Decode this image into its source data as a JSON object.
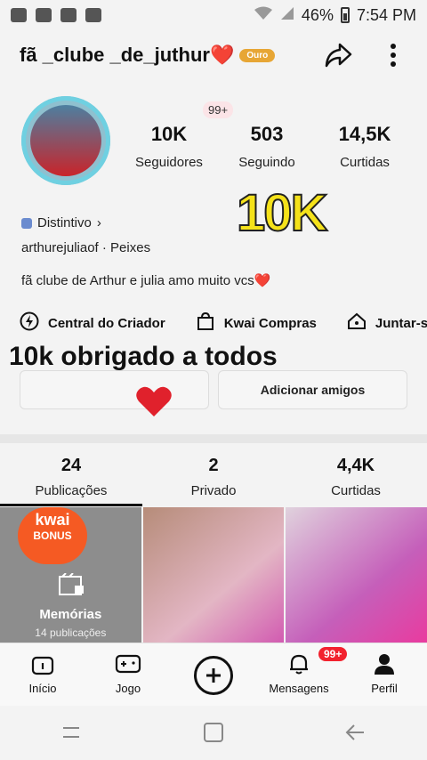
{
  "status": {
    "battery": "46%",
    "time": "7:54 PM"
  },
  "header": {
    "username": "fã _clube _de_juthur❤️",
    "badge": "Ouro"
  },
  "profile": {
    "new_badge": "99+",
    "stats": [
      {
        "value": "10K",
        "label": "Seguidores"
      },
      {
        "value": "503",
        "label": "Seguindo"
      },
      {
        "value": "14,5K",
        "label": "Curtidas"
      }
    ],
    "sticker_text": "10K",
    "distintivo": "Distintivo",
    "handle": "arthurejuliaof · Peixes",
    "bio": "fã clube de Arthur e julia amo muito vcs❤️"
  },
  "shortcuts": [
    "Central do Criador",
    "Kwai Compras",
    "Juntar-s"
  ],
  "overlay_caption": "10k obrigado a todos",
  "buttons": {
    "add_friends": "Adicionar amigos"
  },
  "tabs": [
    {
      "value": "24",
      "label": "Publicações"
    },
    {
      "value": "2",
      "label": "Privado"
    },
    {
      "value": "4,4K",
      "label": "Curtidas"
    }
  ],
  "grid": {
    "bonus_line1": "kwai",
    "bonus_line2": "BONUS",
    "memorias": "Memórias",
    "memorias_count": "14 publicações"
  },
  "bottom_nav": [
    {
      "label": "Início"
    },
    {
      "label": "Jogo"
    },
    {
      "label": ""
    },
    {
      "label": "Mensagens",
      "badge": "99+"
    },
    {
      "label": "Perfil"
    }
  ],
  "colors": {
    "accent_red": "#f2222e",
    "gold": "#e7a635",
    "sticker_yellow": "#f5e21a"
  }
}
